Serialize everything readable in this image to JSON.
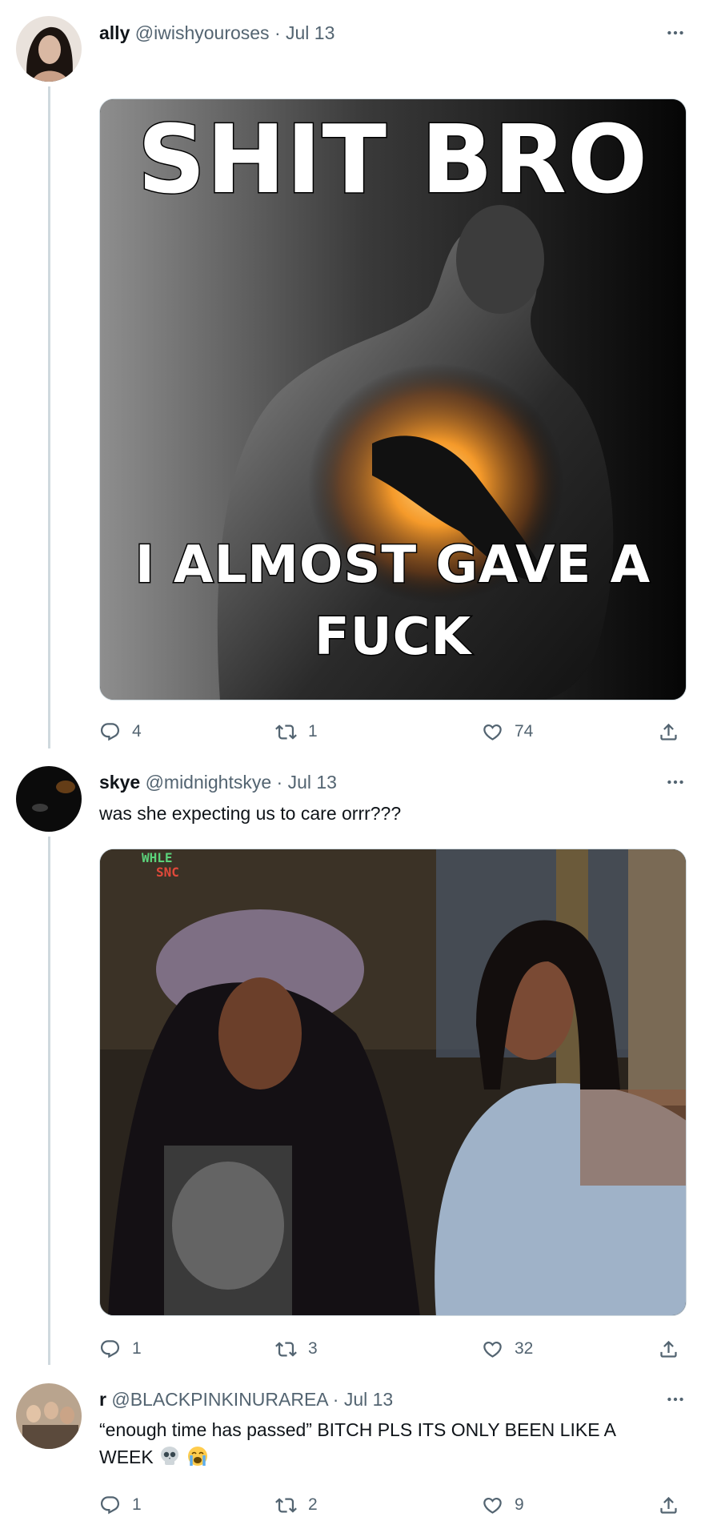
{
  "tweets": [
    {
      "name": "ally",
      "meta": "@iwishyouroses · Jul 13",
      "text": "",
      "meme_top": "SHIT BRO",
      "meme_bottom_1": "I ALMOST GAVE A",
      "meme_bottom_2": "FUCK",
      "replies": "4",
      "retweets": "1",
      "likes": "74"
    },
    {
      "name": "skye",
      "meta": "@midnightskye · Jul 13",
      "text": "was she expecting us to care orrr???",
      "sign_top": "WHLE",
      "sign_bottom": "SNC",
      "replies": "1",
      "retweets": "3",
      "likes": "32"
    },
    {
      "name": "r",
      "meta": "@BLACKPINKINURAREA · Jul 13",
      "text_line1": "“enough time has passed” BITCH PLS ITS ONLY BEEN LIKE A",
      "text_line2": "WEEK",
      "emojis": [
        "skull-emoji",
        "crying-emoji"
      ],
      "replies": "1",
      "retweets": "2",
      "likes": "9"
    }
  ],
  "colors": {
    "text_primary": "#0f1419",
    "text_secondary": "#536471",
    "thread_line": "#cfd9de",
    "border": "#cfd9de"
  },
  "icons": {
    "reply": "reply-icon",
    "retweet": "retweet-icon",
    "like": "heart-icon",
    "share": "share-icon",
    "more": "more-icon"
  }
}
